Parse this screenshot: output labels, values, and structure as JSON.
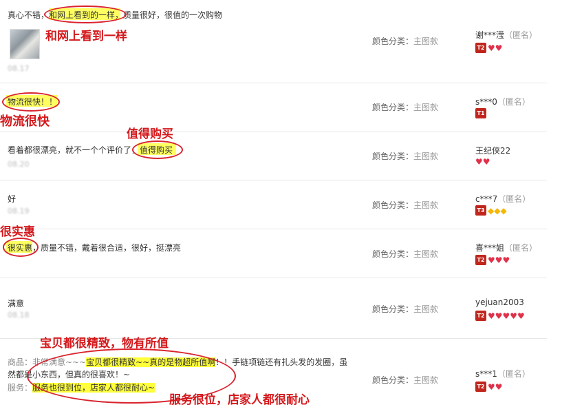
{
  "labels": {
    "color_label": "颜色分类：",
    "color_value": "主图款"
  },
  "reviews": [
    {
      "text_pre": "真心不错，",
      "text_hl": "和网上看到的一样",
      "text_post": "，质量很好，很值的一次购物",
      "date": "08.17",
      "user": "谢***滢",
      "anon": "（匿名）",
      "level": "T2",
      "hearts": "♥♥"
    },
    {
      "text_hl": "物流很快！！",
      "date": "",
      "user": "s***0",
      "anon": "（匿名）",
      "level": "T1",
      "hearts": ""
    },
    {
      "text_pre": "看着都很漂亮，就不一个个评价了，",
      "text_hl": "值得购买",
      "date": "08.20",
      "user": "王纪侠22",
      "anon": "",
      "level": "",
      "hearts": "♥♥"
    },
    {
      "text_pre": "好",
      "date": "08.19",
      "user": "c***7",
      "anon": "（匿名）",
      "level": "T3",
      "gold": "◆◆◆"
    },
    {
      "text_hl": "很实惠",
      "text_post": "，质量不错，戴着很合适，很好，挺漂亮",
      "date": "",
      "user": "喜***姐",
      "anon": "（匿名）",
      "level": "T2",
      "hearts": "♥♥♥"
    },
    {
      "text_pre": "满意",
      "date": "08.18",
      "user": "yejuan2003",
      "anon": "",
      "level": "T2",
      "hearts": "♥♥♥♥♥"
    },
    {
      "line1_pre": "商品：非常满意~~~",
      "line1_hl": "宝贝都很精致~~真的是物超所值啊",
      "line1_post": "！！手链项链还有扎头发的发圈，虽",
      "line2": "然都是小东西，但真的很喜欢！~",
      "line3_pre": "服务：",
      "line3_hl": "服务也很到位，店家人都很耐心~",
      "user": "s***1",
      "anon": "（匿名）",
      "level": "T2",
      "hearts": "♥♥"
    }
  ],
  "annotations": {
    "a1": "和网上看到一样",
    "a2": "物流很快",
    "a3": "值得购买",
    "a4": "很实惠",
    "a5": "宝贝都很精致，物有所值",
    "a6": "服务很位，店家人都很耐心"
  }
}
